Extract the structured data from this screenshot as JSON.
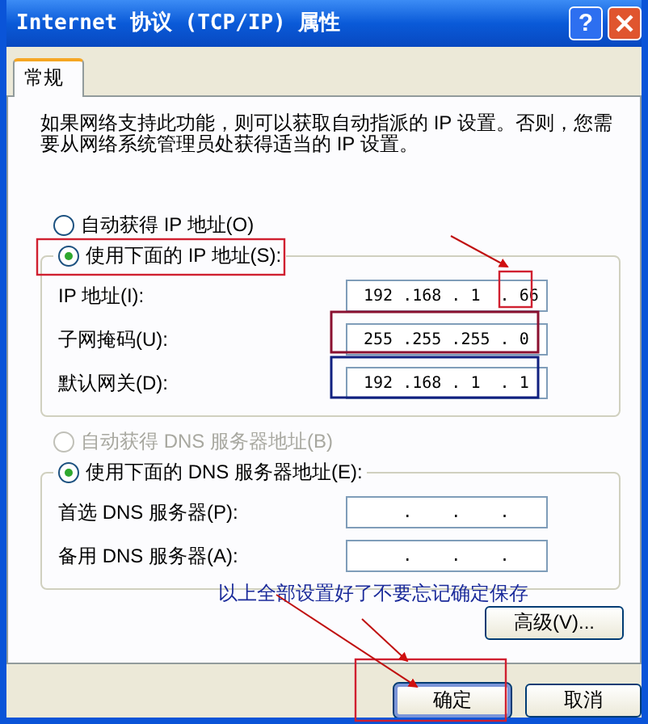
{
  "window": {
    "title": "Internet 协议 (TCP/IP) 属性",
    "help_button": "?"
  },
  "tabs": [
    {
      "label": "常规",
      "selected": true
    }
  ],
  "description": "如果网络支持此功能，则可以获取自动指派的 IP 设置。否则，您需要从网络系统管理员处获得适当的 IP 设置。",
  "ip_mode": [
    {
      "label": "自动获得 IP 地址(O)",
      "selected": false,
      "disabled": false
    },
    {
      "label": "使用下面的 IP 地址(S):",
      "selected": true,
      "disabled": false
    }
  ],
  "ip_fields": [
    {
      "label": "IP 地址(I):",
      "value": "192 .168 . 1  . 66"
    },
    {
      "label": "子网掩码(U):",
      "value": "255 .255 .255 . 0"
    },
    {
      "label": "默认网关(D):",
      "value": "192 .168 . 1  . 1"
    }
  ],
  "dns_mode": [
    {
      "label": "自动获得 DNS 服务器地址(B)",
      "selected": false,
      "disabled": true
    },
    {
      "label": "使用下面的 DNS 服务器地址(E):",
      "selected": true,
      "disabled": false
    }
  ],
  "dns_fields": [
    {
      "label": "首选 DNS 服务器(P):",
      "value": "    .    .    ."
    },
    {
      "label": "备用 DNS 服务器(A):",
      "value": "    .    .    ."
    }
  ],
  "annotation": "以上全部设置好了不要忘记确定保存",
  "advanced_button": "高级(V)...",
  "buttons": [
    {
      "label": "确定",
      "kind": "ok"
    },
    {
      "label": "取消",
      "kind": "cancel"
    }
  ]
}
